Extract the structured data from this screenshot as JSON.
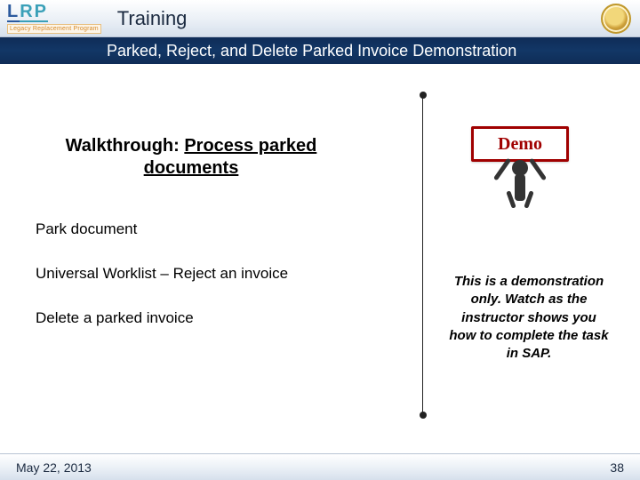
{
  "header": {
    "logo_main_1": "L",
    "logo_main_2": "RP",
    "logo_sub": "Legacy Replacement Program",
    "title": "Training"
  },
  "subbar": {
    "text": "Parked, Reject, and Delete Parked Invoice Demonstration"
  },
  "walkthrough": {
    "prefix": "Walkthrough:  ",
    "topic": "Process parked documents"
  },
  "bullets": {
    "item1": "Park document",
    "item2": "Universal Worklist – Reject an invoice",
    "item3": "Delete a parked invoice"
  },
  "demo": {
    "sign": "Demo",
    "note": "This is a demonstration only. Watch as the instructor shows you how to complete the task in SAP."
  },
  "footer": {
    "date": "May 22, 2013",
    "page": "38"
  }
}
